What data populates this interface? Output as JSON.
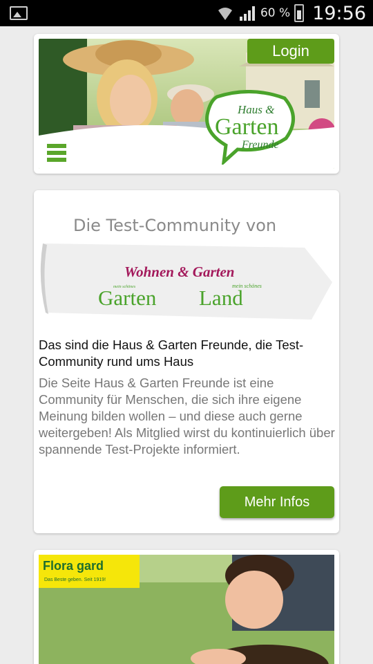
{
  "status_bar": {
    "battery": "60 %",
    "time": "19:56"
  },
  "header": {
    "login_label": "Login",
    "logo": {
      "line1": "Haus &",
      "line2": "Garten",
      "line3": "Freunde"
    }
  },
  "promo": {
    "banner": {
      "headline": "Die Test-Community von",
      "brand1": "Wohnen & Garten",
      "brand2_small": "mein schönes",
      "brand2": "Garten",
      "brand3_small": "mein schönes",
      "brand3": "Land"
    },
    "title": "Das sind die Haus & Garten Freunde, die Test-Community rund ums Haus",
    "text": "Die Seite Haus & Garten Freunde ist eine Community für Menschen, die sich ihre eigene Meinung bilden wollen – und diese auch gerne weitergeben! Als Mitglied wirst du kontinuierlich über spannende Test-Projekte informiert.",
    "more_label": "Mehr Infos"
  },
  "floragard": {
    "name": "Flora gard",
    "tagline": "Das Beste geben. Seit 1919!"
  },
  "colors": {
    "accent": "#5e9c1a",
    "menu": "#5aa62a",
    "logo_green": "#4aa32b",
    "brand_magenta": "#a3195b"
  }
}
